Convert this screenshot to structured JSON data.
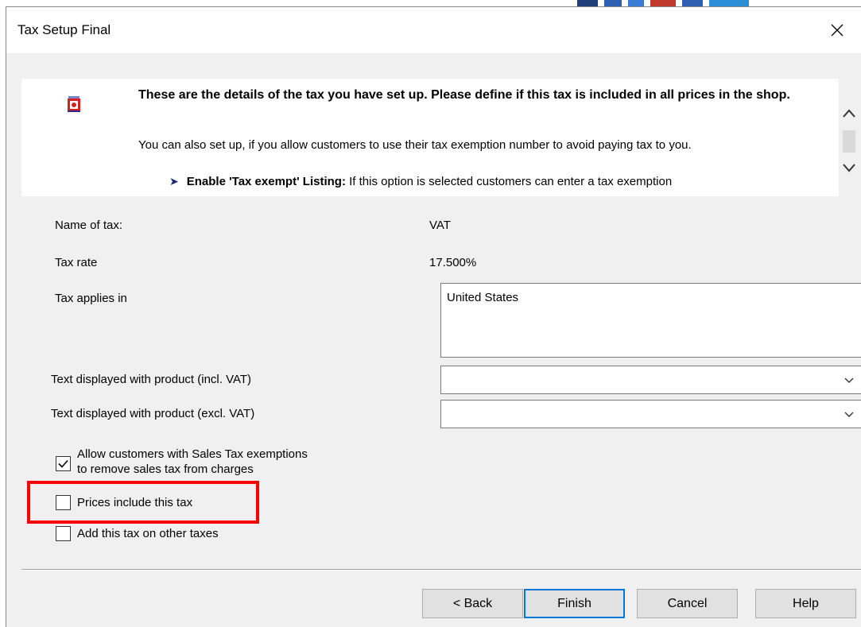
{
  "window": {
    "title": "Tax Setup Final"
  },
  "info": {
    "heading": "These are the details of the tax you have set up. Please define if this tax is included in all prices in the shop.",
    "subtext": "You can also set up, if you allow customers to use their tax exemption number to avoid paying tax to you.",
    "bullet_label": "Enable 'Tax exempt' Listing:",
    "bullet_text": " If this option is selected customers can enter a tax exemption"
  },
  "form": {
    "name_label": "Name of tax:",
    "name_value": "VAT",
    "rate_label": "Tax rate",
    "rate_value": "17.500%",
    "applies_label": "Tax applies in",
    "applies_items": [
      "United States"
    ],
    "text_incl_label": "Text displayed with product (incl. VAT)",
    "text_incl_value": "",
    "text_excl_label": "Text displayed with product (excl. VAT)",
    "text_excl_value": ""
  },
  "options": {
    "allow_exempt_label_line1": "Allow customers with Sales Tax exemptions",
    "allow_exempt_label_line2": "to remove sales tax from charges",
    "allow_exempt_checked": true,
    "prices_include_label": "Prices include this tax",
    "prices_include_checked": false,
    "add_on_other_label": "Add this tax on other taxes",
    "add_on_other_checked": false
  },
  "buttons": {
    "back": "< Back",
    "finish": "Finish",
    "cancel": "Cancel",
    "help": "Help"
  },
  "colors": {
    "highlight": "#ff0000",
    "default_button_border": "#0078d7",
    "dialog_bg": "#f0f0f0"
  }
}
